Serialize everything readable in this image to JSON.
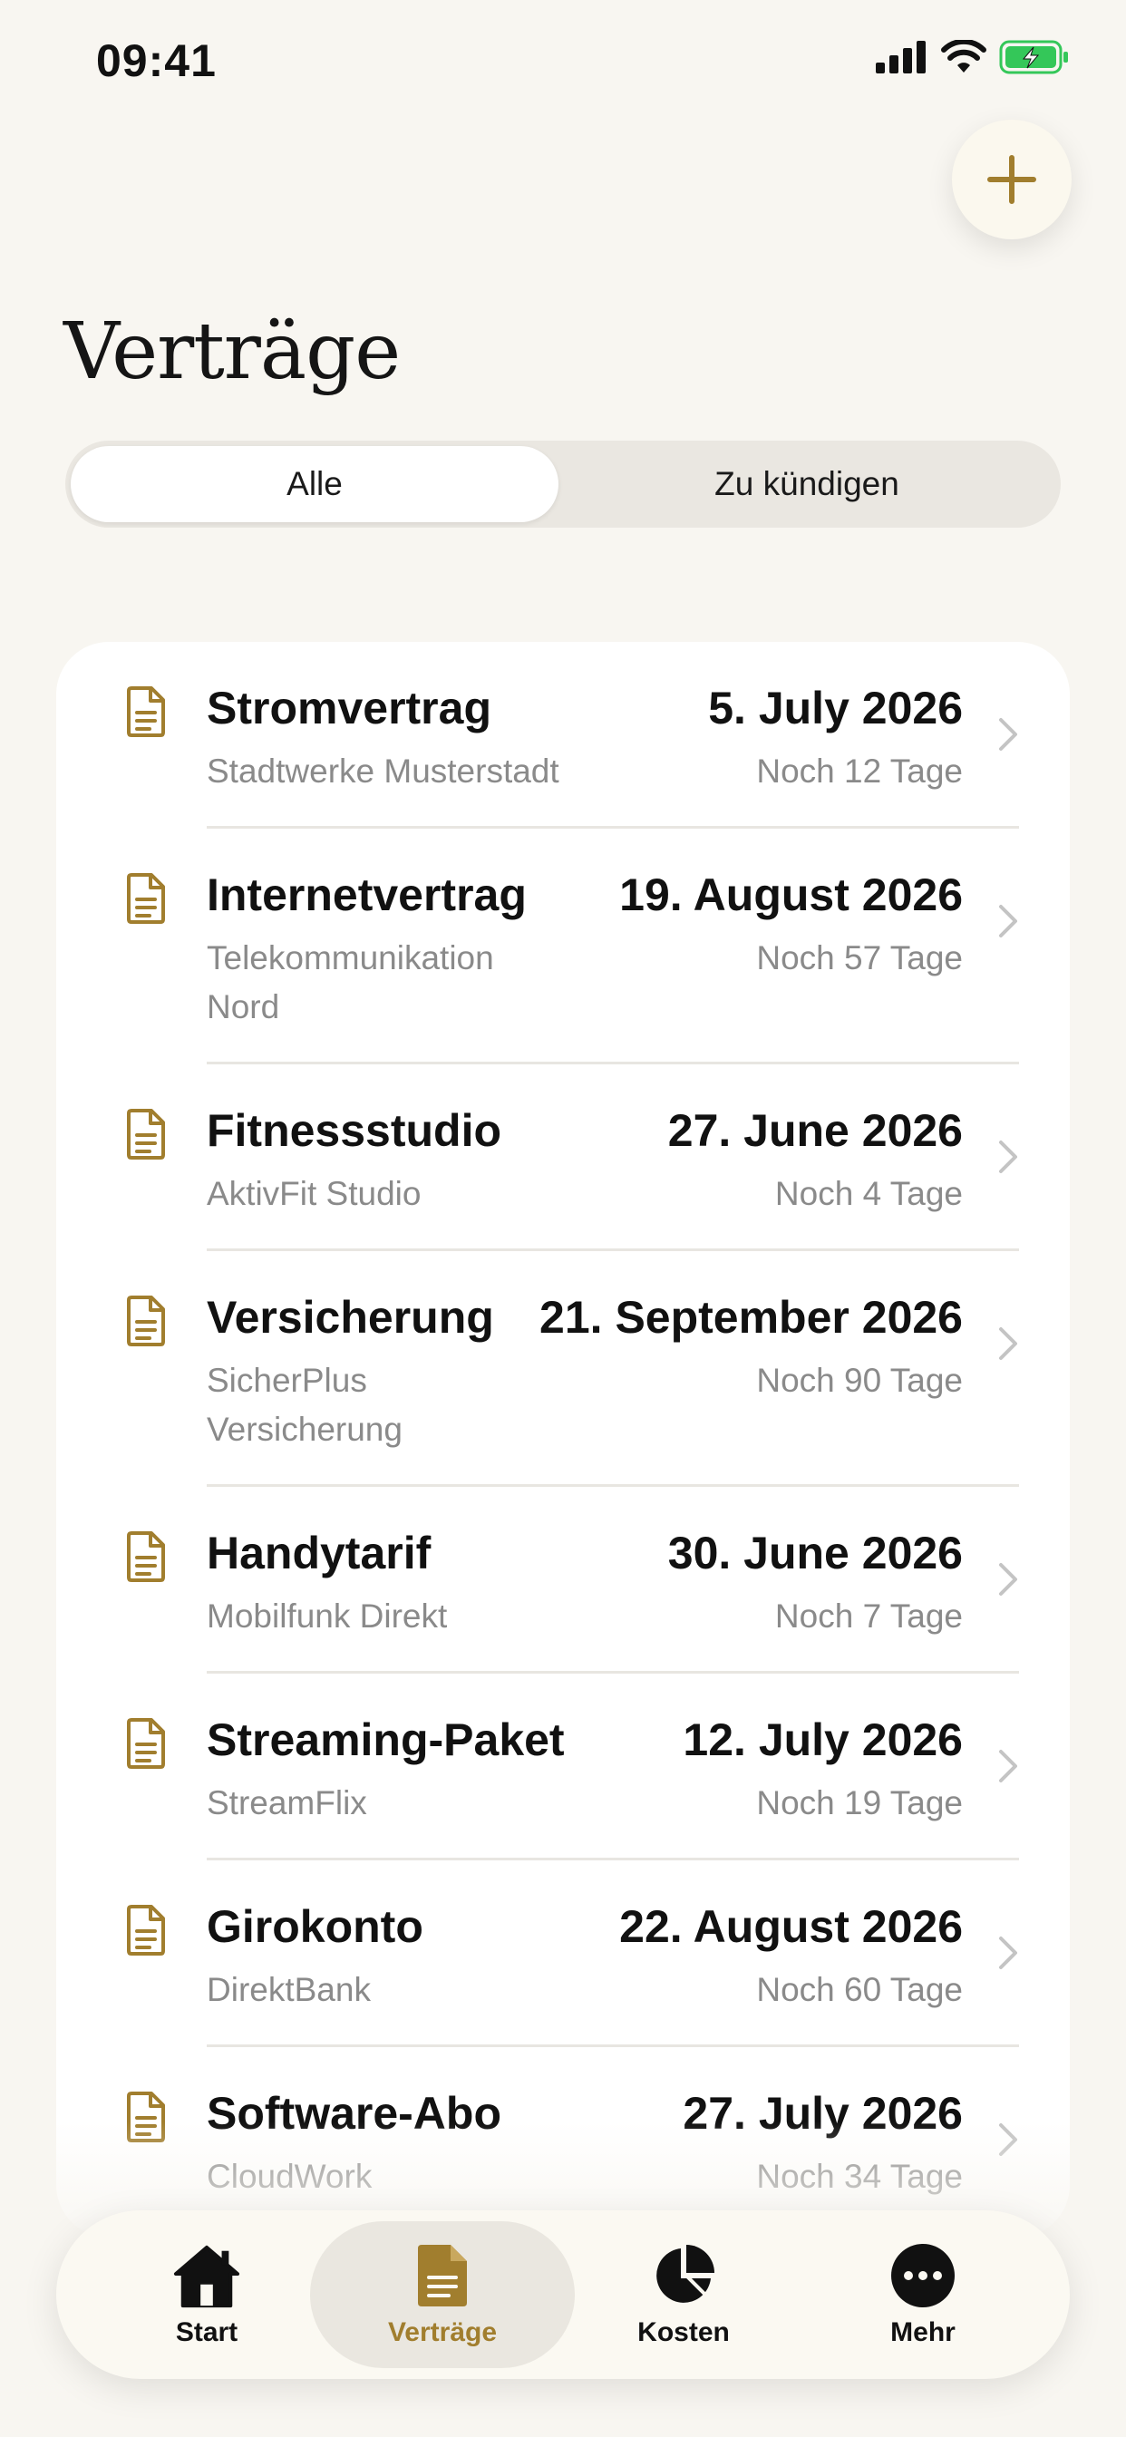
{
  "status_bar": {
    "time": "09:41"
  },
  "header": {
    "title": "Verträge",
    "add_icon": "plus-icon"
  },
  "segments": [
    {
      "label": "Alle",
      "selected": true
    },
    {
      "label": "Zu kündigen",
      "selected": false
    }
  ],
  "contracts": [
    {
      "title": "Stromvertrag",
      "provider": "Stadtwerke Musterstadt",
      "date": "5. July 2026",
      "remaining": "Noch 12 Tage"
    },
    {
      "title": "Internetvertrag",
      "provider": "Telekommunikation Nord",
      "date": "19. August 2026",
      "remaining": "Noch 57 Tage"
    },
    {
      "title": "Fitnessstudio",
      "provider": "AktivFit Studio",
      "date": "27. June 2026",
      "remaining": "Noch 4 Tage"
    },
    {
      "title": "Versicherung",
      "provider": "SicherPlus Versicherung",
      "date": "21. September 2026",
      "remaining": "Noch 90 Tage"
    },
    {
      "title": "Handytarif",
      "provider": "Mobilfunk Direkt",
      "date": "30. June 2026",
      "remaining": "Noch 7 Tage"
    },
    {
      "title": "Streaming-Paket",
      "provider": "StreamFlix",
      "date": "12. July 2026",
      "remaining": "Noch 19 Tage"
    },
    {
      "title": "Girokonto",
      "provider": "DirektBank",
      "date": "22. August 2026",
      "remaining": "Noch 60 Tage"
    },
    {
      "title": "Software-Abo",
      "provider": "CloudWork",
      "date": "27. July 2026",
      "remaining": "Noch 34 Tage"
    }
  ],
  "tabs": [
    {
      "label": "Start",
      "icon": "house-icon",
      "active": false
    },
    {
      "label": "Verträge",
      "icon": "document-icon",
      "active": true
    },
    {
      "label": "Kosten",
      "icon": "pie-chart-icon",
      "active": false
    },
    {
      "label": "Mehr",
      "icon": "more-icon",
      "active": false
    }
  ],
  "colors": {
    "accent": "#A17E2E",
    "background": "#F8F6F1",
    "card": "#FFFFFF",
    "battery": "#34C759"
  }
}
